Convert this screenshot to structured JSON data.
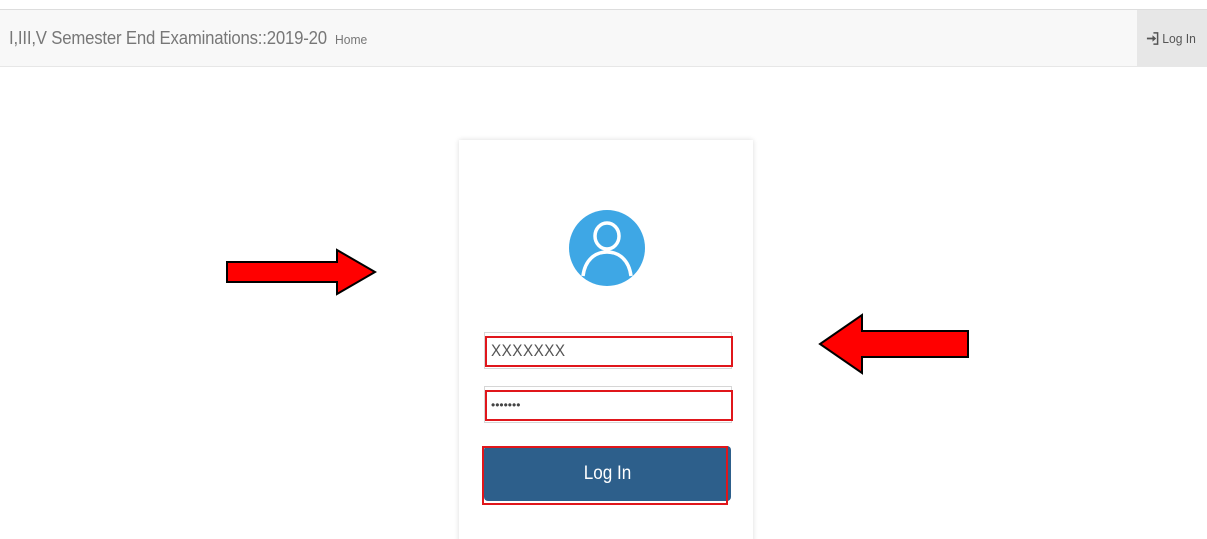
{
  "navbar": {
    "brand": "I,III,V Semester End Examinations::2019-20",
    "home_label": "Home",
    "login_label": "Log In",
    "login_icon": "sign-in-icon",
    "background_color": "#f8f8f8"
  },
  "login_form": {
    "avatar_icon": "user-avatar-icon",
    "avatar_color": "#3ea7e5",
    "username_value": "XXXXXXX",
    "password_value": "•••••••",
    "submit_label": "Log In",
    "button_color": "#2d5f8b",
    "highlight_color": "#e0161b"
  },
  "annotations": {
    "right_arrow": "arrow-right-icon",
    "left_arrow": "arrow-left-icon",
    "arrow_color": "#ff0000"
  }
}
